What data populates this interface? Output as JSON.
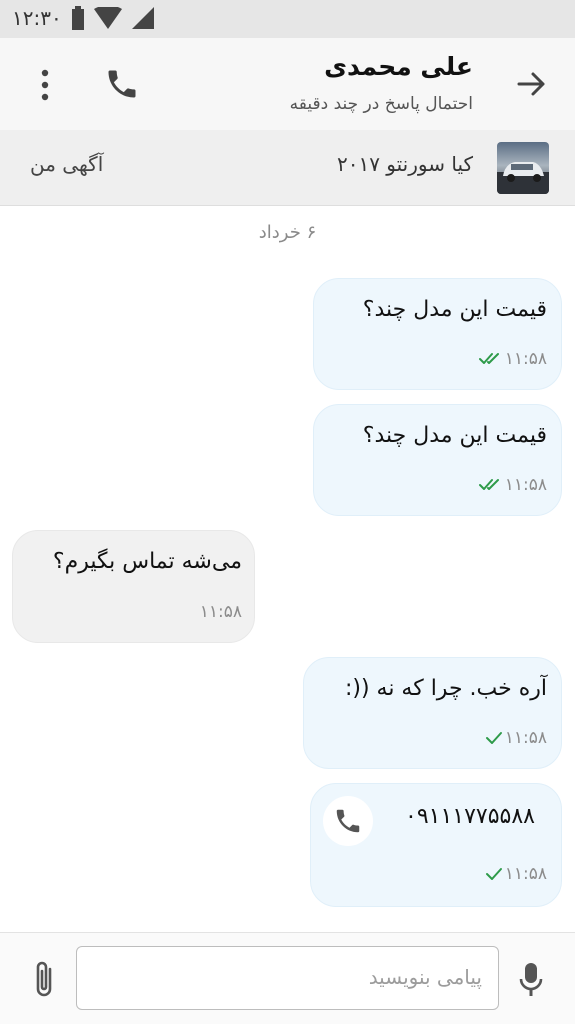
{
  "status_bar": {
    "time": "۱۲:۳۰"
  },
  "header": {
    "contact_name": "علی محمدی",
    "subtitle": "احتمال پاسخ در چند دقیقه"
  },
  "ad": {
    "title": "کیا سورنتو ۲۰۱۷",
    "my_ad_label": "آگهی من"
  },
  "chat": {
    "date_label": "۶ خرداد",
    "messages": [
      {
        "direction": "out",
        "text": "قیمت این مدل چند؟",
        "time": "۱۱:۵۸",
        "status": "read"
      },
      {
        "direction": "out",
        "text": "قیمت این مدل چند؟",
        "time": "۱۱:۵۸",
        "status": "read"
      },
      {
        "direction": "in",
        "text": "می‌شه تماس بگیرم؟",
        "time": "۱۱:۵۸"
      },
      {
        "direction": "out",
        "text": "آره خب. چرا که نه ((:",
        "time": "۱۱:۵۸",
        "status": "sent"
      },
      {
        "direction": "out",
        "text": "۰۹۱۱۱۷۷۵۵۸۸",
        "time": "۱۱:۵۸",
        "status": "sent",
        "type": "phone"
      }
    ]
  },
  "composer": {
    "placeholder": "پیامی بنویسید"
  },
  "colors": {
    "outgoing_bubble": "#eef7fd",
    "incoming_bubble": "#f1f1f1",
    "check_green": "#2e9b4a"
  }
}
